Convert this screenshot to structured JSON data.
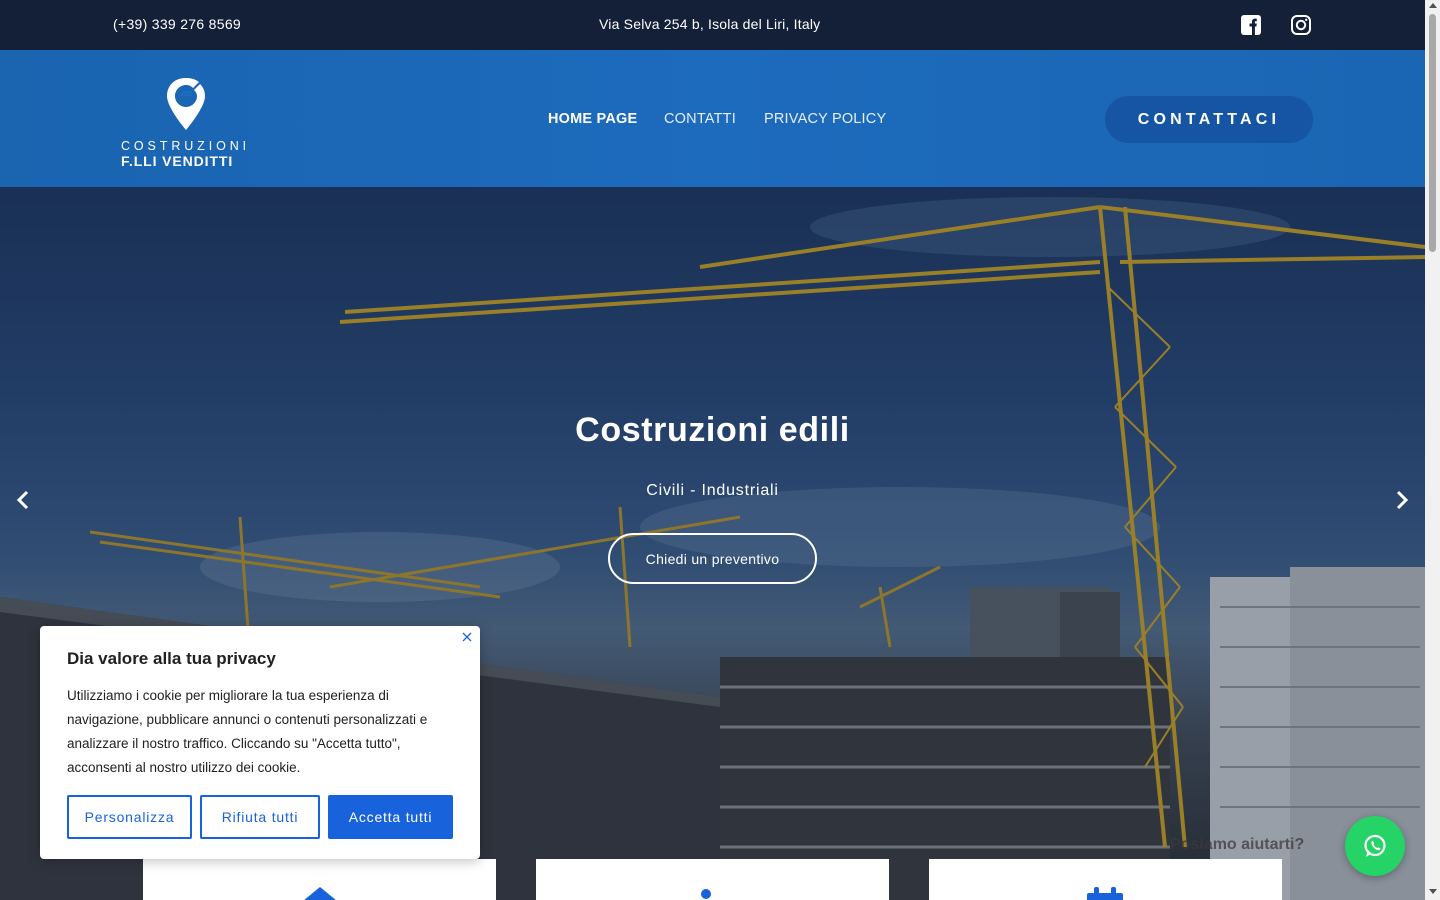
{
  "topbar": {
    "phone": "(+39) 339 276 8569",
    "address": "Via Selva 254 b, Isola del Liri, Italy",
    "social": [
      "facebook-icon",
      "instagram-icon"
    ]
  },
  "header": {
    "logo_line1": "COSTRUZIONI",
    "logo_line2": "F.LLI VENDITTI",
    "nav": [
      {
        "label": "HOME PAGE",
        "active": true
      },
      {
        "label": "CONTATTI",
        "active": false
      },
      {
        "label": "PRIVACY POLICY",
        "active": false
      }
    ],
    "cta_label": "CONTATTACI"
  },
  "hero": {
    "title": "Costruzioni edili",
    "subtitle": "Civili - Industriali",
    "button_label": "Chiedi un preventivo"
  },
  "cards": [
    {
      "icon": "home-icon"
    },
    {
      "icon": "info-icon"
    },
    {
      "icon": "calendar-icon"
    }
  ],
  "cookie_banner": {
    "title": "Dia valore alla tua privacy",
    "text": "Utilizziamo i cookie per migliorare la tua esperienza di navigazione, pubblicare annunci o contenuti personalizzati e analizzare il nostro traffico. Cliccando su \"Accetta tutto\", acconsenti al nostro utilizzo dei cookie.",
    "buttons": {
      "customize": "Personalizza",
      "reject": "Rifiuta tutti",
      "accept": "Accetta tutti"
    }
  },
  "whatsapp": {
    "text": "Posiamo aiutarti?"
  },
  "colors": {
    "topbar": "#141f38",
    "header": "#1d6bbd",
    "cta": "#1555a3",
    "cookie_accent": "#1863dc",
    "whatsapp": "#25d366"
  }
}
